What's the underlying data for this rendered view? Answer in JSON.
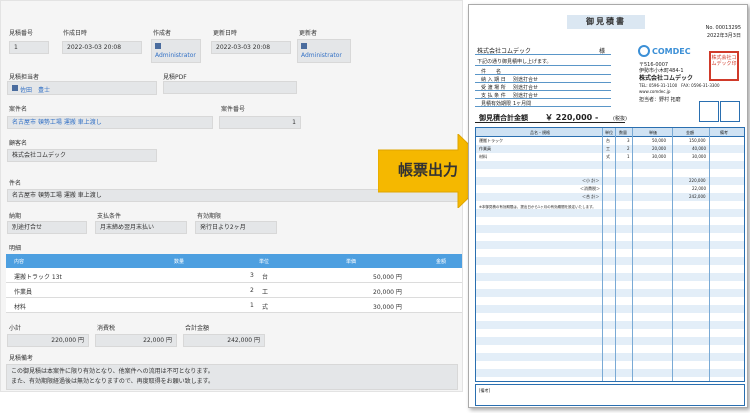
{
  "form": {
    "quote_no": {
      "label": "見積番号",
      "value": "1"
    },
    "created_at": {
      "label": "作成日時",
      "value": "2022-03-03 20:08"
    },
    "creator": {
      "label": "作成者",
      "value": "Administrator"
    },
    "updated_at": {
      "label": "更新日時",
      "value": "2022-03-03 20:08"
    },
    "updater": {
      "label": "更新者",
      "value": "Administrator"
    },
    "person": {
      "label": "見積担当者",
      "value": "佐田　豊士"
    },
    "pdf": {
      "label": "見積PDF"
    },
    "case_name": {
      "label": "案件名",
      "value": "名古屋市 頓勢工場 運搬 車上渡し"
    },
    "case_no": {
      "label": "案件番号",
      "value": "1"
    },
    "customer": {
      "label": "顧客名",
      "value": "株式会社コムデック"
    },
    "subject": {
      "label": "件名",
      "value": "名古屋市 頓勢工場 運搬 車上渡し"
    },
    "delivery": {
      "label": "納期",
      "value": "別途打合せ"
    },
    "payment": {
      "label": "支払条件",
      "value": "月末締め翌月末払い"
    },
    "validity": {
      "label": "有効期限",
      "value": "発行日より2ヶ月"
    },
    "detail_label": "明細",
    "detail_headers": {
      "content": "内容",
      "qty": "数量",
      "unit": "単位",
      "price": "単価",
      "amount": "金額"
    },
    "rows": [
      {
        "content": "運搬トラック 13t",
        "qty": "3",
        "unit": "台",
        "price": "50,000 円"
      },
      {
        "content": "作業員",
        "qty": "2",
        "unit": "工",
        "price": "20,000 円"
      },
      {
        "content": "材料",
        "qty": "1",
        "unit": "式",
        "price": "30,000 円"
      }
    ],
    "subtotal": {
      "label": "小計",
      "value": "220,000 円"
    },
    "tax": {
      "label": "消費税",
      "value": "22,000 円"
    },
    "total": {
      "label": "合計金額",
      "value": "242,000 円"
    },
    "remarks": {
      "label": "見積備考",
      "line1": "この御見積は本案件に限り有効となり、他案件への流用は不可となります。",
      "line2": "また、有効期限経過後は無効となりますので、再度取得をお願い致します。"
    }
  },
  "arrow_label": "帳票出力",
  "doc": {
    "title": "御見積書",
    "no": "No. 00013295",
    "date": "2022年3月3日",
    "to_company": "株式会社コムデック",
    "honorific": "様",
    "intro": "下記の通り御見積申し上げます。",
    "fields": [
      {
        "label": "件　　名",
        "value": ""
      },
      {
        "label": "納 入 期 日",
        "value": "別途打合せ"
      },
      {
        "label": "受 渡 場 所",
        "value": "別途打合せ"
      },
      {
        "label": "支 払 条 件",
        "value": "別途打合せ"
      },
      {
        "label": "見積有効期限",
        "value": "1ヶ月間"
      }
    ],
    "logo_text": "COMDEC",
    "issuer_zip": "〒516-0007",
    "issuer_addr": "伊勢市小木町484-1",
    "issuer_name": "株式会社コムデック",
    "issuer_tel": "TEL: 0596-31-1100　FAX: 0596-31-3300",
    "issuer_web": "www.comdec.jp",
    "issuer_person": "担当者：野村 拓磨",
    "seal_text": "株式会社コムデック印",
    "total_label": "御見積合計金額",
    "total_value": "￥ 220,000 -",
    "tax_note": "(税抜)",
    "headers": {
      "name": "品名・規格",
      "unit": "単位",
      "qty": "数量",
      "price": "単価",
      "amount": "金額",
      "remarks": "備考"
    },
    "rows": [
      {
        "name": "運搬トラック",
        "unit": "台",
        "qty": "3",
        "price": "50,000",
        "amount": "150,000"
      },
      {
        "name": "作業員",
        "unit": "工",
        "qty": "2",
        "price": "20,000",
        "amount": "40,000"
      },
      {
        "name": "材料",
        "unit": "式",
        "qty": "1",
        "price": "30,000",
        "amount": "30,000"
      }
    ],
    "subtotal_label": "＜小 計＞",
    "subtotal_value": "220,000",
    "tax_label": "＜消費税＞",
    "tax_value": "22,000",
    "total2_label": "＜合 計＞",
    "total2_value": "242,000",
    "note": "※本御見積の有効期限は、提出日から1ヶ月の有効期間を設定いたします。",
    "remark_label": "[備考]"
  },
  "colors": {
    "accent": "#4d9fe0",
    "doc_line": "#2a6fb0",
    "arrow": "#f5b800"
  }
}
